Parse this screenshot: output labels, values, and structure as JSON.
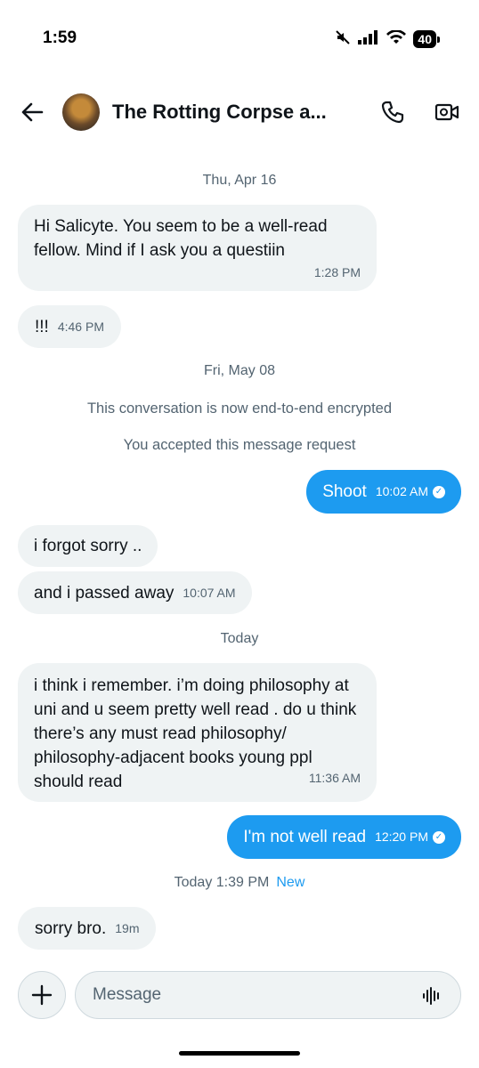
{
  "status": {
    "time": "1:59",
    "battery": "40"
  },
  "header": {
    "title": "The Rotting Corpse a..."
  },
  "messages": {
    "date1": "Thu, Apr 16",
    "m1": {
      "text": "Hi Salicyte. You seem to be a well-read fellow. Mind if I ask you a questiin",
      "time": "1:28 PM"
    },
    "m2": {
      "text": "!!!",
      "time": "4:46 PM"
    },
    "date2": "Fri, May 08",
    "note1": "This conversation is now end-to-end encrypted",
    "note2": "You accepted this message request",
    "m3": {
      "text": "Shoot",
      "time": "10:02 AM"
    },
    "m4": {
      "text": "i forgot sorry .."
    },
    "m5": {
      "text": "and i passed away",
      "time": "10:07 AM"
    },
    "date3": "Today",
    "m6": {
      "text": "i think i remember. i’m doing philosophy at uni and u seem pretty well read . do u think there’s any must read philosophy/ philosophy-adjacent books young ppl should read",
      "time": "11:36 AM"
    },
    "m7": {
      "text": "I'm not well read",
      "time": "12:20 PM"
    },
    "date4": "Today 1:39 PM",
    "new_label": "New",
    "m8": {
      "text": "sorry bro.",
      "time": "19m"
    }
  },
  "composer": {
    "placeholder": "Message"
  },
  "colors": {
    "accent": "#1d9bf0",
    "bubble_in": "#eff3f4",
    "muted_text": "#536471"
  },
  "icons": {
    "back": "arrow-left-icon",
    "call": "phone-icon",
    "video": "video-camera-icon",
    "add": "plus-icon",
    "voice": "voice-waveform-icon",
    "sent": "check-circle-icon"
  }
}
